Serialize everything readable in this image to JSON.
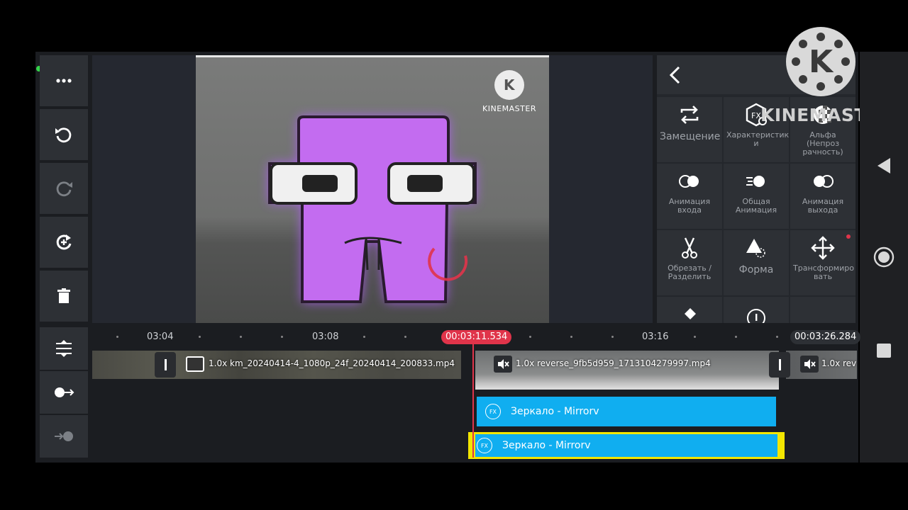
{
  "left_toolbar": {
    "items": [
      "more-icon",
      "undo-icon",
      "redo-icon",
      "replay-icon",
      "trash-icon"
    ]
  },
  "left_toolbar_bottom": {
    "items": [
      "track-adjust-icon",
      "record-left-icon",
      "record-right-icon"
    ]
  },
  "preview": {
    "watermark_text": "KINEMASTER"
  },
  "panel": {
    "back_label": "<",
    "items": [
      {
        "label": "Замещение",
        "icon": "replace-icon"
      },
      {
        "label": "Характеристик и",
        "icon": "fx-settings-icon"
      },
      {
        "label": "Альфа (Непроз рачность)",
        "icon": "alpha-icon"
      },
      {
        "label": "Анимация входа",
        "icon": "in-animation-icon"
      },
      {
        "label": "Общая Анимация",
        "icon": "overall-animation-icon"
      },
      {
        "label": "Анимация выхода",
        "icon": "out-animation-icon"
      },
      {
        "label": "Обрезать / Разделить",
        "icon": "scissors-icon"
      },
      {
        "label": "Форма",
        "icon": "shape-icon"
      },
      {
        "label": "Трансформиро вать",
        "icon": "transform-icon"
      }
    ]
  },
  "watermark": {
    "logo_letter": "K",
    "text": "KINEMASTER"
  },
  "timeline": {
    "ruler_labels": [
      "03:04",
      "03:08",
      "03:16"
    ],
    "current_time": "00:03:11.534",
    "end_time": "00:03:26.284",
    "clips": [
      {
        "label": "1.0x km_20240414-4_1080p_24f_20240414_200833.mp4"
      },
      {
        "label": "1.0x reverse_9fb5d959_1713104279997.mp4"
      },
      {
        "label": "1.0x rev"
      }
    ],
    "effect_layers": [
      {
        "label": "Зеркало - Mirrorv",
        "fx": "FX"
      },
      {
        "label": "Зеркало - Mirrorv",
        "fx": "FX"
      }
    ]
  },
  "colors": {
    "accent_red": "#e0344a",
    "fx_blue": "#10aef0",
    "selection_yellow": "#f3e600",
    "character_purple": "#c36cf0"
  }
}
